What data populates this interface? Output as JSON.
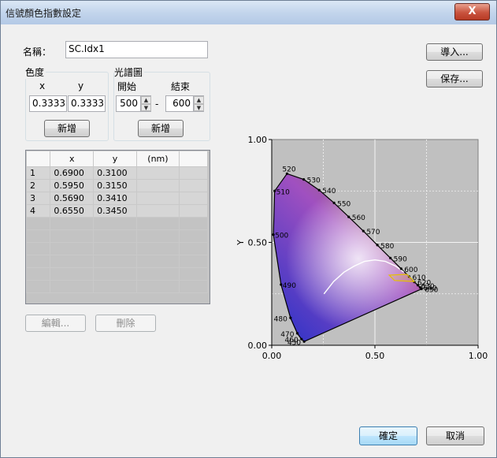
{
  "window": {
    "title": "信號顏色指數設定",
    "close_label": "X"
  },
  "name": {
    "label": "名稱：",
    "value": "SC.Idx1"
  },
  "chromaticity": {
    "group_label": "色度",
    "x_label": "x",
    "y_label": "y",
    "x_value": "0.3333",
    "y_value": "0.3333",
    "add_label": "新增"
  },
  "spectrum": {
    "group_label": "光譜圖",
    "start_label": "開始",
    "end_label": "結束",
    "start_value": "500",
    "end_value": "600",
    "separator": "-",
    "add_label": "新增"
  },
  "table": {
    "headers": [
      "",
      "x",
      "y",
      "(nm)",
      ""
    ],
    "rows": [
      {
        "n": "1",
        "x": "0.6900",
        "y": "0.3100"
      },
      {
        "n": "2",
        "x": "0.5950",
        "y": "0.3150"
      },
      {
        "n": "3",
        "x": "0.5690",
        "y": "0.3410"
      },
      {
        "n": "4",
        "x": "0.6550",
        "y": "0.3450"
      }
    ]
  },
  "buttons": {
    "edit": "編輯...",
    "delete": "刪除",
    "import": "導入...",
    "save": "保存...",
    "ok": "確定",
    "cancel": "取消"
  },
  "chart_data": {
    "type": "scatter",
    "title": "",
    "xlabel": "",
    "ylabel": "Y",
    "xlim": [
      0,
      1
    ],
    "ylim": [
      0,
      1
    ],
    "x_ticks": [
      "0.00",
      "0.50",
      "1.00"
    ],
    "y_ticks": [
      "0.00",
      "0.50",
      "1.00"
    ],
    "grid": true,
    "locus_labels": [
      {
        "nm": "460",
        "x": 0.144,
        "y": 0.03
      },
      {
        "nm": "450",
        "x": 0.157,
        "y": 0.018
      },
      {
        "nm": "470",
        "x": 0.124,
        "y": 0.058
      },
      {
        "nm": "480",
        "x": 0.091,
        "y": 0.133
      },
      {
        "nm": "490",
        "x": 0.045,
        "y": 0.295
      },
      {
        "nm": "500",
        "x": 0.008,
        "y": 0.538
      },
      {
        "nm": "510",
        "x": 0.014,
        "y": 0.75
      },
      {
        "nm": "520",
        "x": 0.074,
        "y": 0.834
      },
      {
        "nm": "530",
        "x": 0.155,
        "y": 0.806
      },
      {
        "nm": "540",
        "x": 0.23,
        "y": 0.754
      },
      {
        "nm": "550",
        "x": 0.302,
        "y": 0.692
      },
      {
        "nm": "560",
        "x": 0.373,
        "y": 0.624
      },
      {
        "nm": "570",
        "x": 0.444,
        "y": 0.555
      },
      {
        "nm": "580",
        "x": 0.512,
        "y": 0.487
      },
      {
        "nm": "590",
        "x": 0.575,
        "y": 0.424
      },
      {
        "nm": "600",
        "x": 0.627,
        "y": 0.372
      },
      {
        "nm": "610",
        "x": 0.666,
        "y": 0.334
      },
      {
        "nm": "620",
        "x": 0.691,
        "y": 0.308
      },
      {
        "nm": "630",
        "x": 0.708,
        "y": 0.292
      },
      {
        "nm": "640",
        "x": 0.719,
        "y": 0.281
      },
      {
        "nm": "650",
        "x": 0.726,
        "y": 0.274
      }
    ],
    "region_polygon": [
      {
        "x": 0.69,
        "y": 0.31
      },
      {
        "x": 0.595,
        "y": 0.315
      },
      {
        "x": 0.569,
        "y": 0.341
      },
      {
        "x": 0.655,
        "y": 0.345
      }
    ],
    "colors": {
      "region": "#e6c000",
      "background": "#c0c0c0",
      "planckian": "#ffffff"
    }
  }
}
